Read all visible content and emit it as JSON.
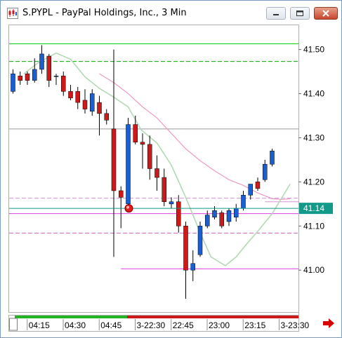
{
  "window": {
    "title": "S.PYPL - PayPal Holdings, Inc., 3 Min",
    "buttons": {
      "minimize": "minimize-icon",
      "maximize": "maximize-icon",
      "close": "close-icon"
    }
  },
  "chart_data": {
    "type": "candlestick",
    "title": "S.PYPL - PayPal Holdings, Inc., 3 Min",
    "xlabel": "",
    "ylabel": "",
    "ylim": [
      40.905,
      41.555
    ],
    "y_ticks": [
      41.5,
      41.4,
      41.3,
      41.2,
      41.1,
      41.0
    ],
    "y_tick_labels": [
      "41.50",
      "41.40",
      "41.30",
      "41.20",
      "41.10",
      "41.00"
    ],
    "last_price": 41.14,
    "last_price_label": "41.14",
    "x_tick_labels": [
      {
        "index": 1,
        "label": "04:15"
      },
      {
        "index": 6,
        "label": "04:30"
      },
      {
        "index": 11,
        "label": "04:45"
      },
      {
        "index": 16,
        "label": "3-22:30"
      },
      {
        "index": 21,
        "label": "22:45"
      },
      {
        "index": 26,
        "label": "23:00"
      },
      {
        "index": 31,
        "label": "23:15"
      },
      {
        "index": 36,
        "label": "3-23:30"
      }
    ],
    "candles": [
      {
        "o": 41.405,
        "h": 41.455,
        "l": 41.4,
        "c": 41.445
      },
      {
        "o": 41.44,
        "h": 41.45,
        "l": 41.42,
        "c": 41.43
      },
      {
        "o": 41.445,
        "h": 41.45,
        "l": 41.42,
        "c": 41.43
      },
      {
        "o": 41.43,
        "h": 41.48,
        "l": 41.425,
        "c": 41.455
      },
      {
        "o": 41.455,
        "h": 41.51,
        "l": 41.445,
        "c": 41.49
      },
      {
        "o": 41.485,
        "h": 41.49,
        "l": 41.415,
        "c": 41.43
      },
      {
        "o": 41.44,
        "h": 41.445,
        "l": 41.42,
        "c": 41.44
      },
      {
        "o": 41.44,
        "h": 41.45,
        "l": 41.395,
        "c": 41.405
      },
      {
        "o": 41.405,
        "h": 41.42,
        "l": 41.385,
        "c": 41.39
      },
      {
        "o": 41.405,
        "h": 41.415,
        "l": 41.365,
        "c": 41.38
      },
      {
        "o": 41.385,
        "h": 41.41,
        "l": 41.355,
        "c": 41.365
      },
      {
        "o": 41.36,
        "h": 41.41,
        "l": 41.35,
        "c": 41.4
      },
      {
        "o": 41.38,
        "h": 41.395,
        "l": 41.305,
        "c": 41.355
      },
      {
        "o": 41.355,
        "h": 41.365,
        "l": 41.33,
        "c": 41.34
      },
      {
        "o": 41.32,
        "h": 41.5,
        "l": 41.03,
        "c": 41.18
      },
      {
        "o": 41.18,
        "h": 41.19,
        "l": 41.095,
        "c": 41.165
      },
      {
        "o": 41.15,
        "h": 41.345,
        "l": 41.145,
        "c": 41.33
      },
      {
        "o": 41.33,
        "h": 41.35,
        "l": 41.285,
        "c": 41.29
      },
      {
        "o": 41.29,
        "h": 41.31,
        "l": 41.23,
        "c": 41.285
      },
      {
        "o": 41.285,
        "h": 41.305,
        "l": 41.205,
        "c": 41.23
      },
      {
        "o": 41.23,
        "h": 41.26,
        "l": 41.18,
        "c": 41.21
      },
      {
        "o": 41.21,
        "h": 41.23,
        "l": 41.145,
        "c": 41.155
      },
      {
        "o": 41.15,
        "h": 41.165,
        "l": 41.14,
        "c": 41.155
      },
      {
        "o": 41.155,
        "h": 41.17,
        "l": 41.085,
        "c": 41.1
      },
      {
        "o": 41.1,
        "h": 41.11,
        "l": 40.935,
        "c": 41.0
      },
      {
        "o": 41.0,
        "h": 41.045,
        "l": 40.975,
        "c": 41.015
      },
      {
        "o": 41.035,
        "h": 41.11,
        "l": 41.03,
        "c": 41.1
      },
      {
        "o": 41.1,
        "h": 41.135,
        "l": 41.095,
        "c": 41.125
      },
      {
        "o": 41.12,
        "h": 41.145,
        "l": 41.115,
        "c": 41.135
      },
      {
        "o": 41.13,
        "h": 41.135,
        "l": 41.095,
        "c": 41.1
      },
      {
        "o": 41.11,
        "h": 41.14,
        "l": 41.1,
        "c": 41.135
      },
      {
        "o": 41.12,
        "h": 41.15,
        "l": 41.11,
        "c": 41.14
      },
      {
        "o": 41.14,
        "h": 41.18,
        "l": 41.135,
        "c": 41.17
      },
      {
        "o": 41.17,
        "h": 41.195,
        "l": 41.16,
        "c": 41.195
      },
      {
        "o": 41.2,
        "h": 41.21,
        "l": 41.18,
        "c": 41.185
      },
      {
        "o": 41.205,
        "h": 41.25,
        "l": 41.2,
        "c": 41.24
      },
      {
        "o": 41.24,
        "h": 41.275,
        "l": 41.235,
        "c": 41.27
      }
    ],
    "ma_fast": [
      {
        "i": 1.5,
        "v": 41.445
      },
      {
        "i": 3.5,
        "v": 41.47
      },
      {
        "i": 6,
        "v": 41.492
      },
      {
        "i": 8,
        "v": 41.478
      },
      {
        "i": 10,
        "v": 41.438
      },
      {
        "i": 12,
        "v": 41.412
      },
      {
        "i": 14,
        "v": 41.392
      },
      {
        "i": 16,
        "v": 41.37
      },
      {
        "i": 17.8,
        "v": 41.318
      },
      {
        "i": 20,
        "v": 41.288
      },
      {
        "i": 22,
        "v": 41.238
      },
      {
        "i": 24,
        "v": 41.165
      },
      {
        "i": 26,
        "v": 41.085
      },
      {
        "i": 27.5,
        "v": 41.03
      },
      {
        "i": 29.5,
        "v": 41.01
      },
      {
        "i": 31,
        "v": 41.03
      },
      {
        "i": 32.5,
        "v": 41.06
      },
      {
        "i": 34,
        "v": 41.088
      },
      {
        "i": 36,
        "v": 41.128
      },
      {
        "i": 37.5,
        "v": 41.168
      },
      {
        "i": 38.5,
        "v": 41.195
      }
    ],
    "ma_slow": [
      {
        "i": 12,
        "v": 41.445
      },
      {
        "i": 14,
        "v": 41.425
      },
      {
        "i": 16,
        "v": 41.4
      },
      {
        "i": 18,
        "v": 41.37
      },
      {
        "i": 20,
        "v": 41.345
      },
      {
        "i": 22,
        "v": 41.31
      },
      {
        "i": 24,
        "v": 41.275
      },
      {
        "i": 26,
        "v": 41.248
      },
      {
        "i": 28,
        "v": 41.225
      },
      {
        "i": 30,
        "v": 41.205
      },
      {
        "i": 32,
        "v": 41.192
      },
      {
        "i": 34,
        "v": 41.175
      },
      {
        "i": 36,
        "v": 41.162
      },
      {
        "i": 37.5,
        "v": 41.16
      },
      {
        "i": 38.5,
        "v": 41.162
      }
    ],
    "h_lines": [
      {
        "y": 41.513,
        "color": "#00cc00",
        "style": "solid"
      },
      {
        "y": 41.473,
        "color": "#00aa00",
        "style": "dashed"
      },
      {
        "y": 41.32,
        "color": "#9a9a9a",
        "style": "solid"
      },
      {
        "y": 41.163,
        "color": "#d98fd9",
        "style": "dashed"
      },
      {
        "y": 41.155,
        "color": "#d98fd9",
        "style": "solid",
        "start_index": 35
      },
      {
        "y": 41.128,
        "color": "#e040e0",
        "style": "solid"
      },
      {
        "y": 41.084,
        "color": "#d060c0",
        "style": "dashed"
      },
      {
        "y": 41.003,
        "color": "#e040e0",
        "style": "solid",
        "start_index": 15
      }
    ],
    "grid": false,
    "colors": {
      "up": "#1a5fd1",
      "down": "#cc1a1a",
      "last_price_bg": "#11998a",
      "ma_fast": "#b3d9b3",
      "ma_slow": "#f08fc0"
    }
  }
}
